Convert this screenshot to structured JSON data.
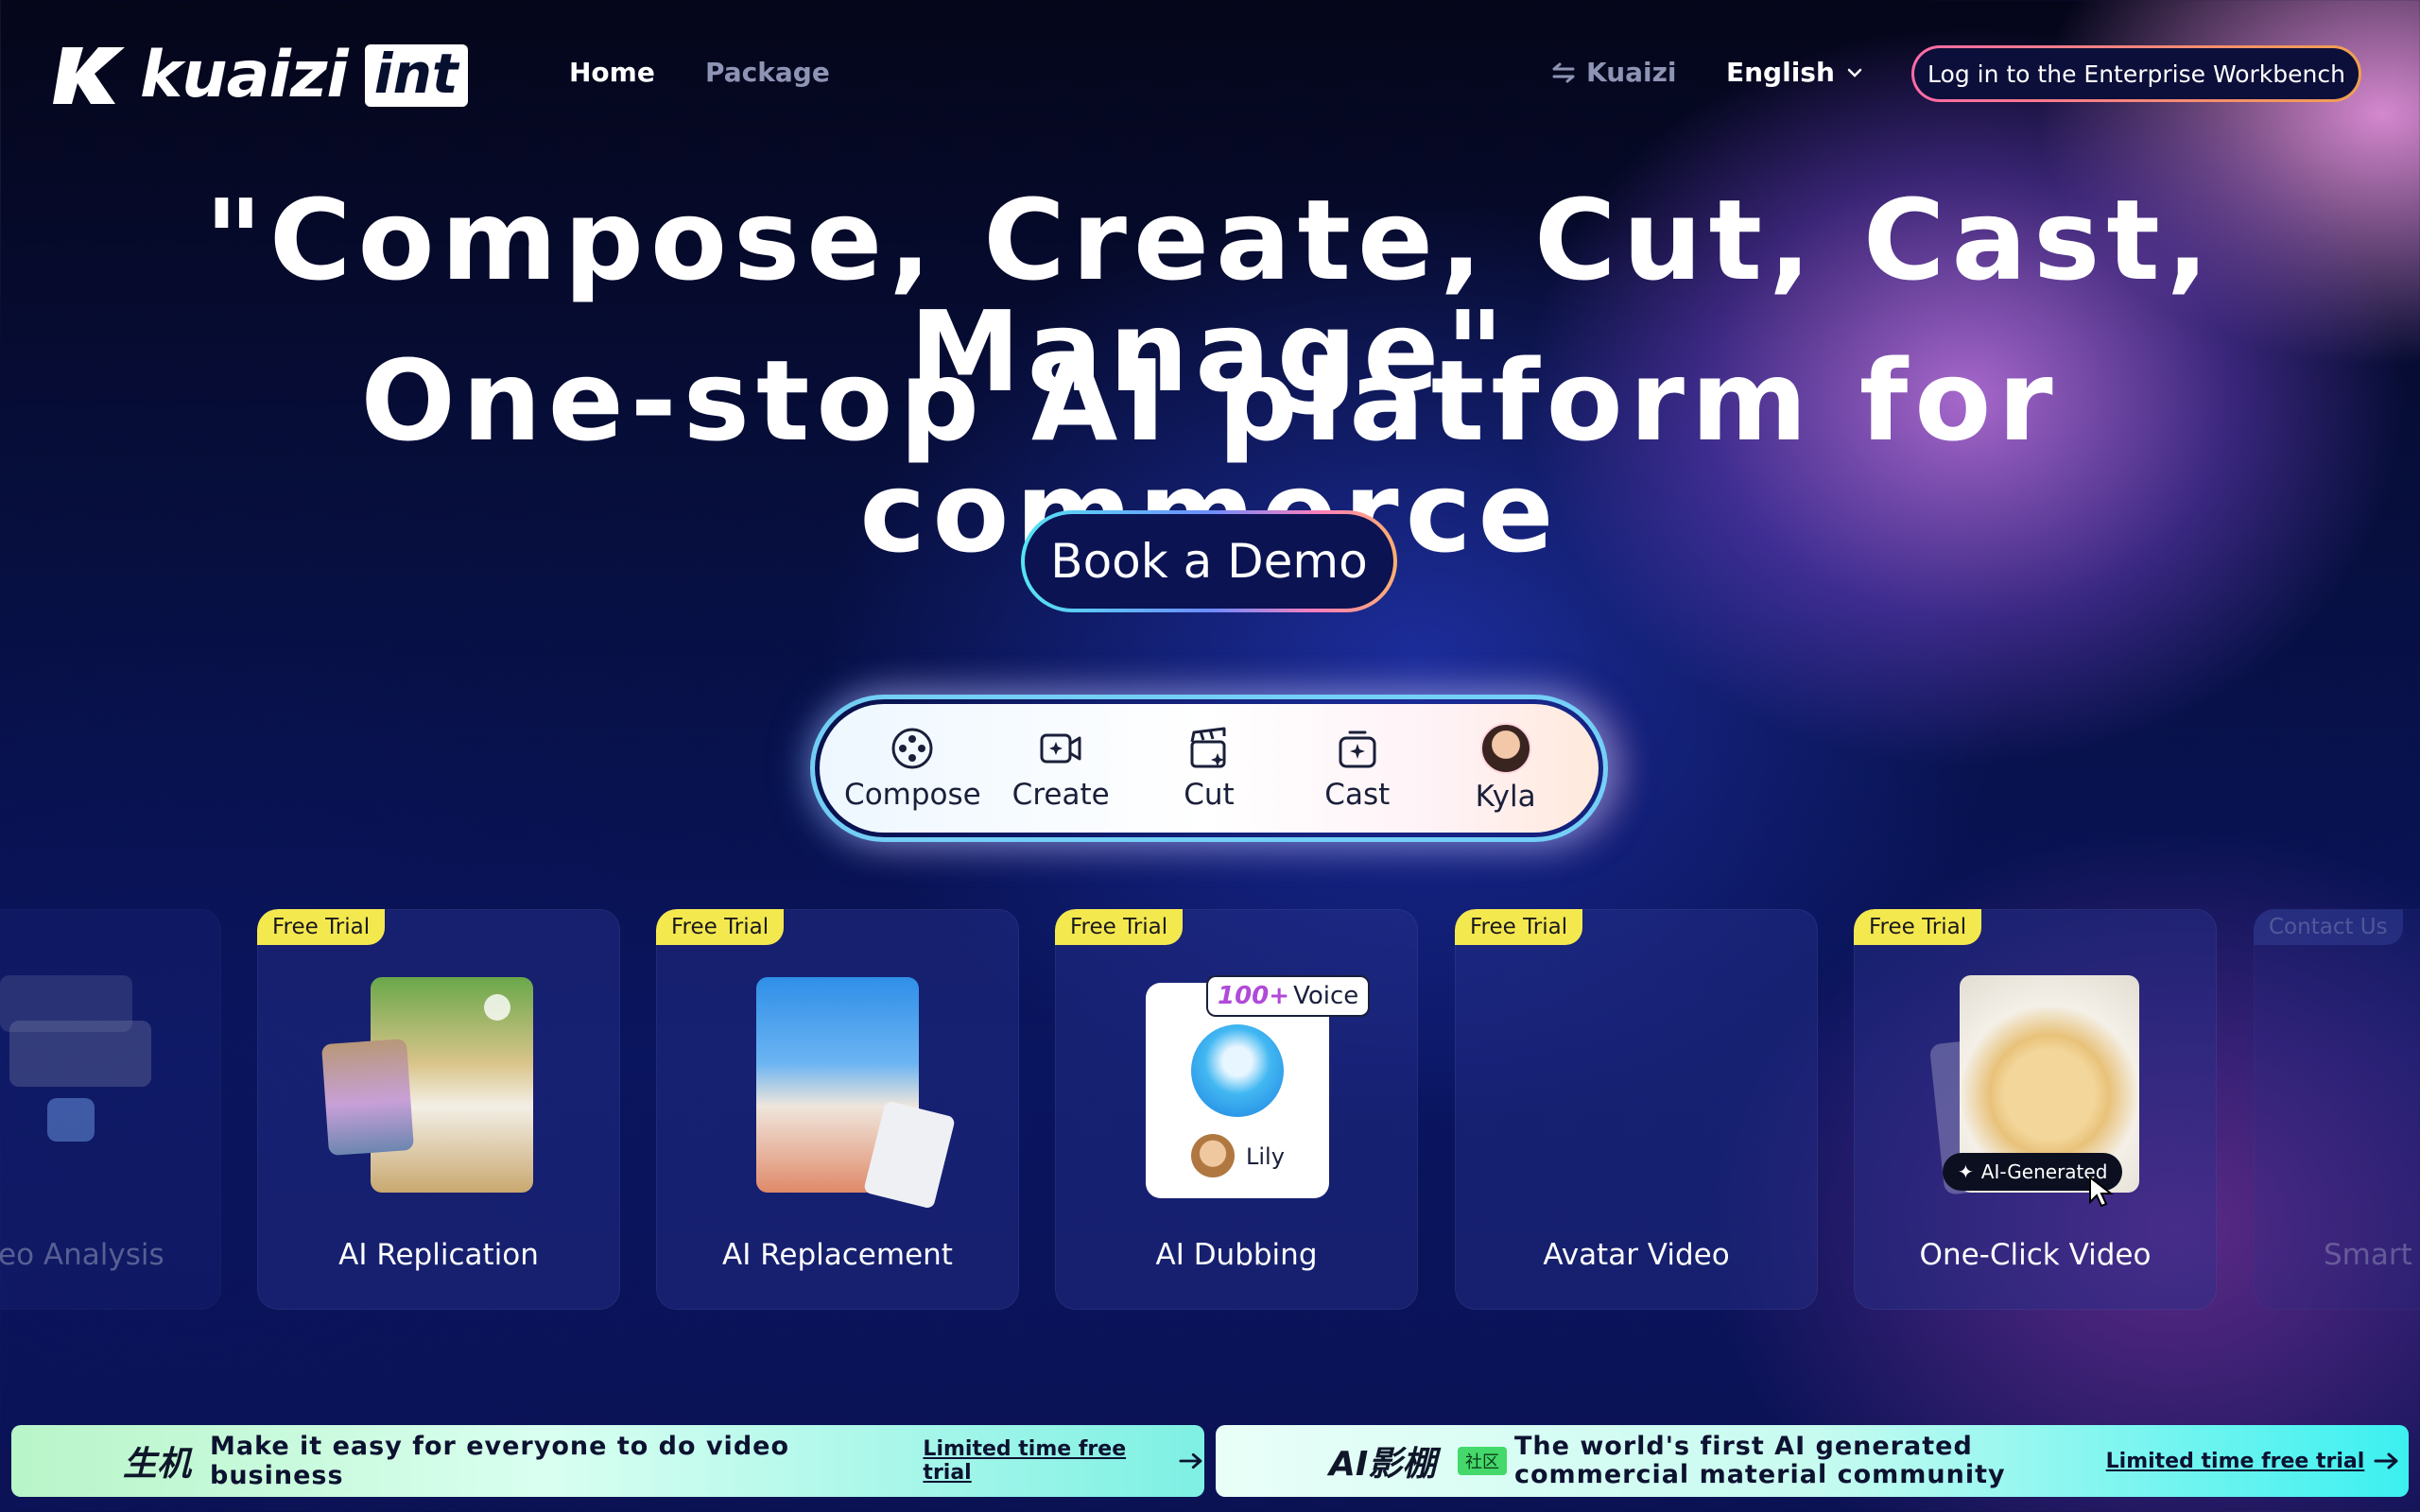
{
  "header": {
    "logo_text": "kuaizi",
    "logo_badge": "int",
    "nav": {
      "home": "Home",
      "package": "Package"
    },
    "switch_label": "Kuaizi",
    "language": "English",
    "enterprise_button": "Log in to the Enterprise Workbench"
  },
  "hero": {
    "line1": "\"Compose, Create, Cut, Cast, Manage\"",
    "line2": "One-stop AI platform for commerce",
    "demo_button": "Book a Demo"
  },
  "tools": [
    {
      "label": "Compose",
      "icon": "compose-icon"
    },
    {
      "label": "Create",
      "icon": "create-icon"
    },
    {
      "label": "Cut",
      "icon": "cut-icon"
    },
    {
      "label": "Cast",
      "icon": "cast-icon"
    },
    {
      "label": "Kyla",
      "icon": "avatar"
    }
  ],
  "cards": [
    {
      "title": "eo Analysis",
      "badge": ""
    },
    {
      "title": "AI Replication",
      "badge": "Free Trial"
    },
    {
      "title": "AI Replacement",
      "badge": "Free Trial"
    },
    {
      "title": "AI Dubbing",
      "badge": "Free Trial",
      "voice_tag_num": "100+",
      "voice_tag_text": "Voice",
      "voice_name": "Lily"
    },
    {
      "title": "Avatar Video",
      "badge": "Free Trial"
    },
    {
      "title": "One-Click Video",
      "badge": "Free Trial",
      "ai_tag": "AI-Generated"
    },
    {
      "title": "Smart",
      "badge": "Contact Us"
    }
  ],
  "banners": {
    "left": {
      "logo": "生机",
      "text": "Make it easy for everyone to do video business",
      "link": "Limited time free trial"
    },
    "right": {
      "logo": "AI影棚",
      "tag": "社区",
      "text_line1": "The world's first AI generated",
      "text_line2": "commercial material community",
      "link": "Limited time free trial"
    }
  },
  "colors": {
    "accent_yellow": "#f4e84f",
    "border_pink": "#ff6ba7",
    "border_orange": "#f0a050"
  }
}
